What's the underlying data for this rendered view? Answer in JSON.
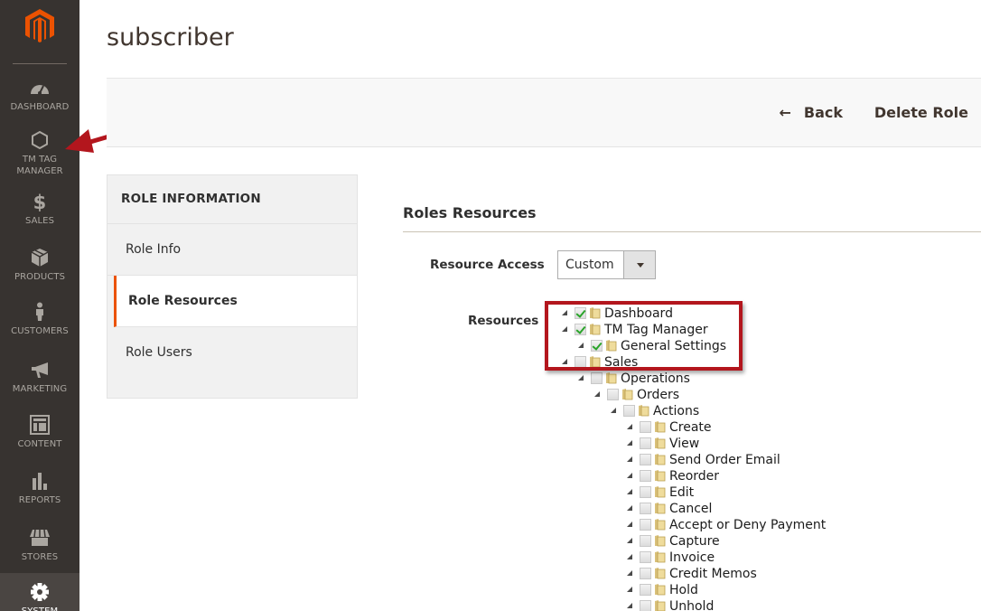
{
  "sidebar": {
    "logo": "magento-logo",
    "items": [
      {
        "label": "DASHBOARD",
        "icon": "dashboard-icon"
      },
      {
        "label": "TM TAG MANAGER",
        "label_lines": [
          "TM TAG",
          "MANAGER"
        ],
        "icon": "hexagon-icon"
      },
      {
        "label": "SALES",
        "icon": "dollar-icon"
      },
      {
        "label": "PRODUCTS",
        "icon": "box-icon"
      },
      {
        "label": "CUSTOMERS",
        "icon": "person-icon"
      },
      {
        "label": "MARKETING",
        "icon": "megaphone-icon"
      },
      {
        "label": "CONTENT",
        "icon": "layout-icon"
      },
      {
        "label": "REPORTS",
        "icon": "bar-chart-icon"
      },
      {
        "label": "STORES",
        "icon": "store-icon"
      },
      {
        "label": "SYSTEM",
        "icon": "gear-icon",
        "active": true
      }
    ]
  },
  "page": {
    "title": "subscriber"
  },
  "actions": {
    "back_label": "Back",
    "back_icon": "←",
    "delete_label": "Delete Role"
  },
  "tabs": {
    "header": "ROLE INFORMATION",
    "items": [
      {
        "label": "Role Info",
        "active": false
      },
      {
        "label": "Role Resources",
        "active": true
      },
      {
        "label": "Role Users",
        "active": false
      }
    ]
  },
  "resources": {
    "section_title": "Roles Resources",
    "access_label": "Resource Access",
    "access_value": "Custom",
    "resources_label": "Resources",
    "tree": [
      {
        "label": "Dashboard",
        "level": 0,
        "checked": true
      },
      {
        "label": "TM Tag Manager",
        "level": 0,
        "checked": true
      },
      {
        "label": "General Settings",
        "level": 1,
        "checked": true
      },
      {
        "label": "Sales",
        "level": 0,
        "checked": false
      },
      {
        "label": "Operations",
        "level": 1,
        "checked": false
      },
      {
        "label": "Orders",
        "level": 2,
        "checked": false
      },
      {
        "label": "Actions",
        "level": 3,
        "checked": false
      },
      {
        "label": "Create",
        "level": 4,
        "checked": false
      },
      {
        "label": "View",
        "level": 4,
        "checked": false
      },
      {
        "label": "Send Order Email",
        "level": 4,
        "checked": false
      },
      {
        "label": "Reorder",
        "level": 4,
        "checked": false
      },
      {
        "label": "Edit",
        "level": 4,
        "checked": false
      },
      {
        "label": "Cancel",
        "level": 4,
        "checked": false
      },
      {
        "label": "Accept or Deny Payment",
        "level": 4,
        "checked": false
      },
      {
        "label": "Capture",
        "level": 4,
        "checked": false
      },
      {
        "label": "Invoice",
        "level": 4,
        "checked": false
      },
      {
        "label": "Credit Memos",
        "level": 4,
        "checked": false
      },
      {
        "label": "Hold",
        "level": 4,
        "checked": false
      },
      {
        "label": "Unhold",
        "level": 4,
        "checked": false
      }
    ]
  },
  "colors": {
    "sidebar_bg": "#373330",
    "brand_orange": "#eb5202",
    "annotation_red": "#b3161d",
    "check_green": "#2aa42a"
  }
}
